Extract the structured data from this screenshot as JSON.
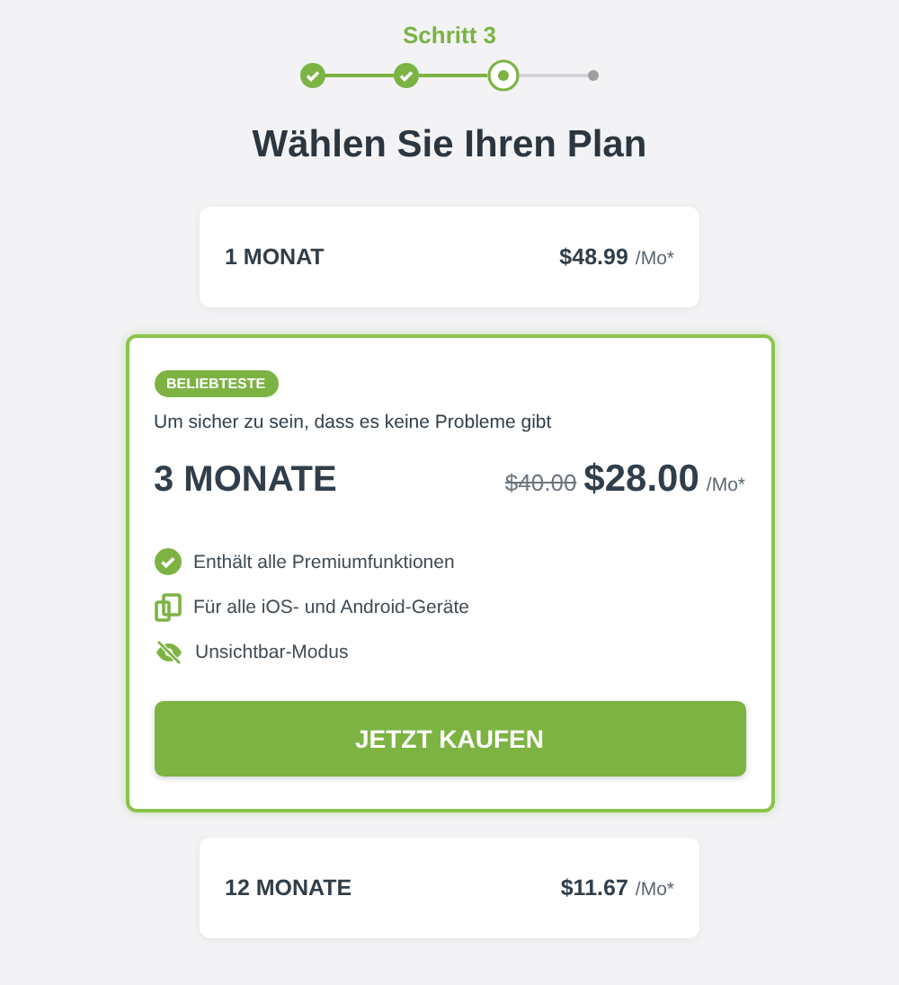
{
  "step_label": "Schritt 3",
  "steps": [
    {
      "done": true,
      "current": false
    },
    {
      "done": true,
      "current": false
    },
    {
      "done": false,
      "current": true
    },
    {
      "done": false,
      "current": false
    }
  ],
  "title": "Wählen Sie Ihren Plan",
  "plans": [
    {
      "name": "1 MONAT",
      "price": "$48.99",
      "unit": "/Mo*",
      "selected": false
    },
    {
      "name": "3 MONATE",
      "price": "$28.00",
      "unit": "/Mo*",
      "selected": true,
      "badge": "BELIEBTESTE",
      "subtitle": "Um sicher zu sein, dass es keine Probleme gibt",
      "old_price": "$40.00",
      "features": [
        {
          "kind": "check",
          "text": "Enthält alle Premiumfunktionen"
        },
        {
          "kind": "devices",
          "text": "Für alle iOS- und Android-Geräte"
        },
        {
          "kind": "hidden",
          "text": "Unsichtbar-Modus"
        }
      ],
      "button": "JETZT KAUFEN"
    },
    {
      "name": "12 MONATE",
      "price": "$11.67",
      "unit": "/Mo*",
      "selected": false
    }
  ]
}
